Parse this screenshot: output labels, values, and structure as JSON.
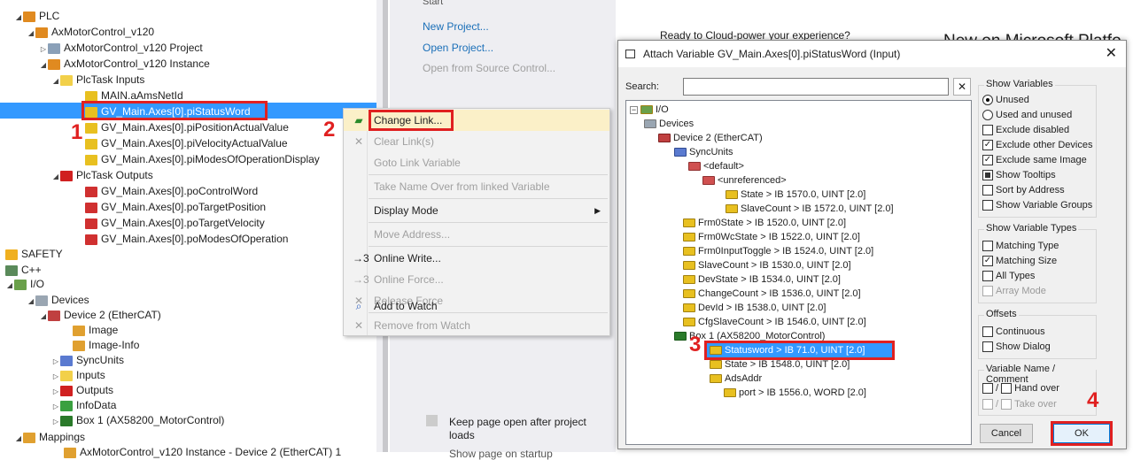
{
  "tree": {
    "plc": "PLC",
    "project": "AxMotorControl_v120",
    "project_sub": "AxMotorControl_v120 Project",
    "instance": "AxMotorControl_v120 Instance",
    "inputs_group": "PlcTask Inputs",
    "inputs": [
      "MAIN.aAmsNetId",
      "GV_Main.Axes[0].piStatusWord",
      "GV_Main.Axes[0].piPositionActualValue",
      "GV_Main.Axes[0].piVelocityActualValue",
      "GV_Main.Axes[0].piModesOfOperationDisplay"
    ],
    "outputs_group": "PlcTask Outputs",
    "outputs": [
      "GV_Main.Axes[0].poControlWord",
      "GV_Main.Axes[0].poTargetPosition",
      "GV_Main.Axes[0].poTargetVelocity",
      "GV_Main.Axes[0].poModesOfOperation"
    ],
    "safety": "SAFETY",
    "cpp": "C++",
    "io": "I/O",
    "devices": "Devices",
    "device2": "Device 2 (EtherCAT)",
    "dev_children": [
      "Image",
      "Image-Info",
      "SyncUnits",
      "Inputs",
      "Outputs",
      "InfoData",
      "Box 1 (AX58200_MotorControl)"
    ],
    "mappings": "Mappings",
    "mapping_item": "AxMotorControl_v120 Instance - Device 2 (EtherCAT) 1"
  },
  "start": {
    "top_cut": "Start",
    "new_project": "New Project...",
    "open_project": "Open Project...",
    "open_source": "Open from Source Control...",
    "keep_open": "Keep page open after project loads",
    "bottom_cut": "Show page on startup"
  },
  "right": {
    "cloud": "Ready to Cloud-power your experience?",
    "news": "New on Microsoft Platfo"
  },
  "context_menu": {
    "items": [
      "Change Link...",
      "Clear Link(s)",
      "Goto Link Variable",
      "Take Name Over from linked Variable",
      "Display Mode",
      "Move Address...",
      "Online Write...",
      "Online Force...",
      "Release Force",
      "Add to Watch",
      "Remove from Watch"
    ]
  },
  "dialog": {
    "title": "Attach Variable GV_Main.Axes[0].piStatusWord (Input)",
    "search_label": "Search:",
    "tree": {
      "io": "I/O",
      "devices": "Devices",
      "device2": "Device 2 (EtherCAT)",
      "syncunits": "SyncUnits",
      "default": "<default>",
      "unreferenced": "<unreferenced>",
      "rows": [
        "State  >  IB 1570.0, UINT [2.0]",
        "SlaveCount  >  IB 1572.0, UINT [2.0]",
        "Frm0State  >  IB 1520.0, UINT [2.0]",
        "Frm0WcState  >  IB 1522.0, UINT [2.0]",
        "Frm0InputToggle  >  IB 1524.0, UINT [2.0]",
        "SlaveCount  >  IB 1530.0, UINT [2.0]",
        "DevState  >  IB 1534.0, UINT [2.0]",
        "ChangeCount  >  IB 1536.0, UINT [2.0]",
        "DevId  >  IB 1538.0, UINT [2.0]",
        "CfgSlaveCount  >  IB 1546.0, UINT [2.0]"
      ],
      "box1": "Box 1 (AX58200_MotorControl)",
      "statusword": "Statusword  >  IB 71.0, UINT [2.0]",
      "state2": "State  >  IB 1548.0, UINT [2.0]",
      "adsaddr": "AdsAddr",
      "port": "port  >  IB 1556.0, WORD [2.0]"
    },
    "show_variables": {
      "title": "Show Variables",
      "options": [
        "Unused",
        "Used and unused",
        "Exclude disabled",
        "Exclude other Devices",
        "Exclude same Image",
        "Show Tooltips",
        "Sort by Address",
        "Show Variable Groups"
      ]
    },
    "show_types": {
      "title": "Show Variable Types",
      "options": [
        "Matching Type",
        "Matching Size",
        "All Types",
        "Array Mode"
      ]
    },
    "offsets": {
      "title": "Offsets",
      "options": [
        "Continuous",
        "Show Dialog"
      ]
    },
    "varname": {
      "title": "Variable Name / Comment",
      "options": [
        "Hand over",
        "Take over"
      ],
      "sep": "/"
    },
    "cancel": "Cancel",
    "ok": "OK"
  },
  "badges": [
    "1",
    "2",
    "3",
    "4"
  ],
  "colors": {
    "highlight": "#3399ff",
    "annotation": "#e02020",
    "link": "#1a6fb8"
  }
}
